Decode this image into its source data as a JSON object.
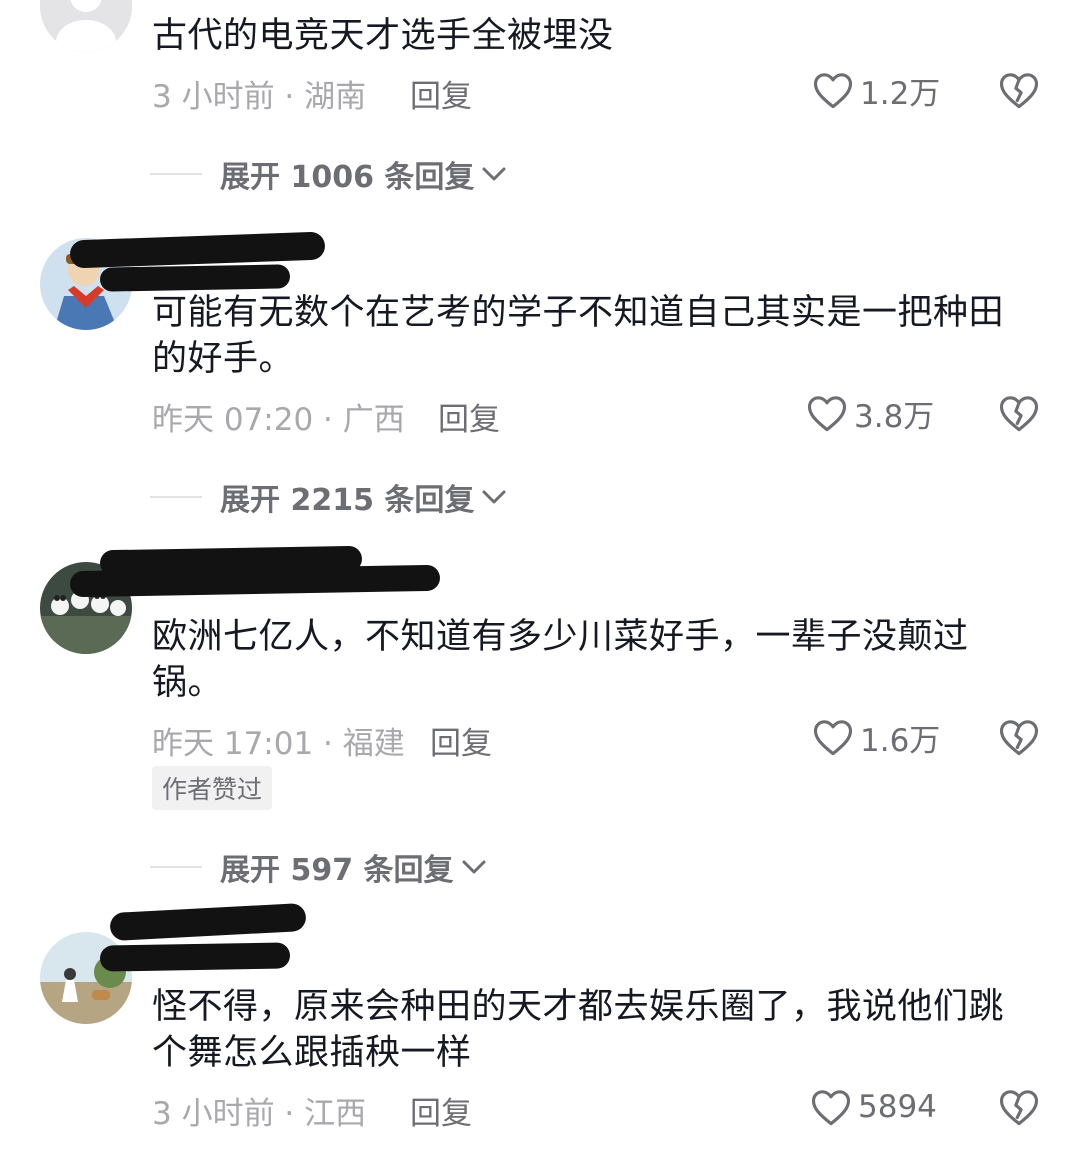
{
  "comments": [
    {
      "text": "古代的电竞天才选手全被埋没",
      "meta": "3 小时前 · 湖南",
      "reply_label": "回复",
      "likes": "1.2万",
      "expand_label": "展开 1006 条回复"
    },
    {
      "text": "可能有无数个在艺考的学子不知道自己其实是一把种田的好手。",
      "meta": "昨天 07:20 · 广西",
      "reply_label": "回复",
      "likes": "3.8万",
      "expand_label": "展开 2215 条回复"
    },
    {
      "text": "欧洲七亿人，不知道有多少川菜好手，一辈子没颠过锅。",
      "meta": "昨天 17:01 · 福建",
      "reply_label": "回复",
      "likes": "1.6万",
      "badge": "作者赞过",
      "expand_label": "展开 597 条回复"
    },
    {
      "text": "怪不得，原来会种田的天才都去娱乐圈了，我说他们跳个舞怎么跟插秧一样",
      "meta": "3 小时前 · 江西",
      "reply_label": "回复",
      "likes": "5894"
    }
  ],
  "colors": {
    "text_primary": "#161823",
    "text_secondary": "#6d6e74",
    "text_tertiary": "#a8a8ad",
    "redaction": "#121212"
  },
  "icons": {
    "like": "heart-outline-icon",
    "dislike": "broken-heart-icon",
    "expand": "chevron-down-icon"
  }
}
